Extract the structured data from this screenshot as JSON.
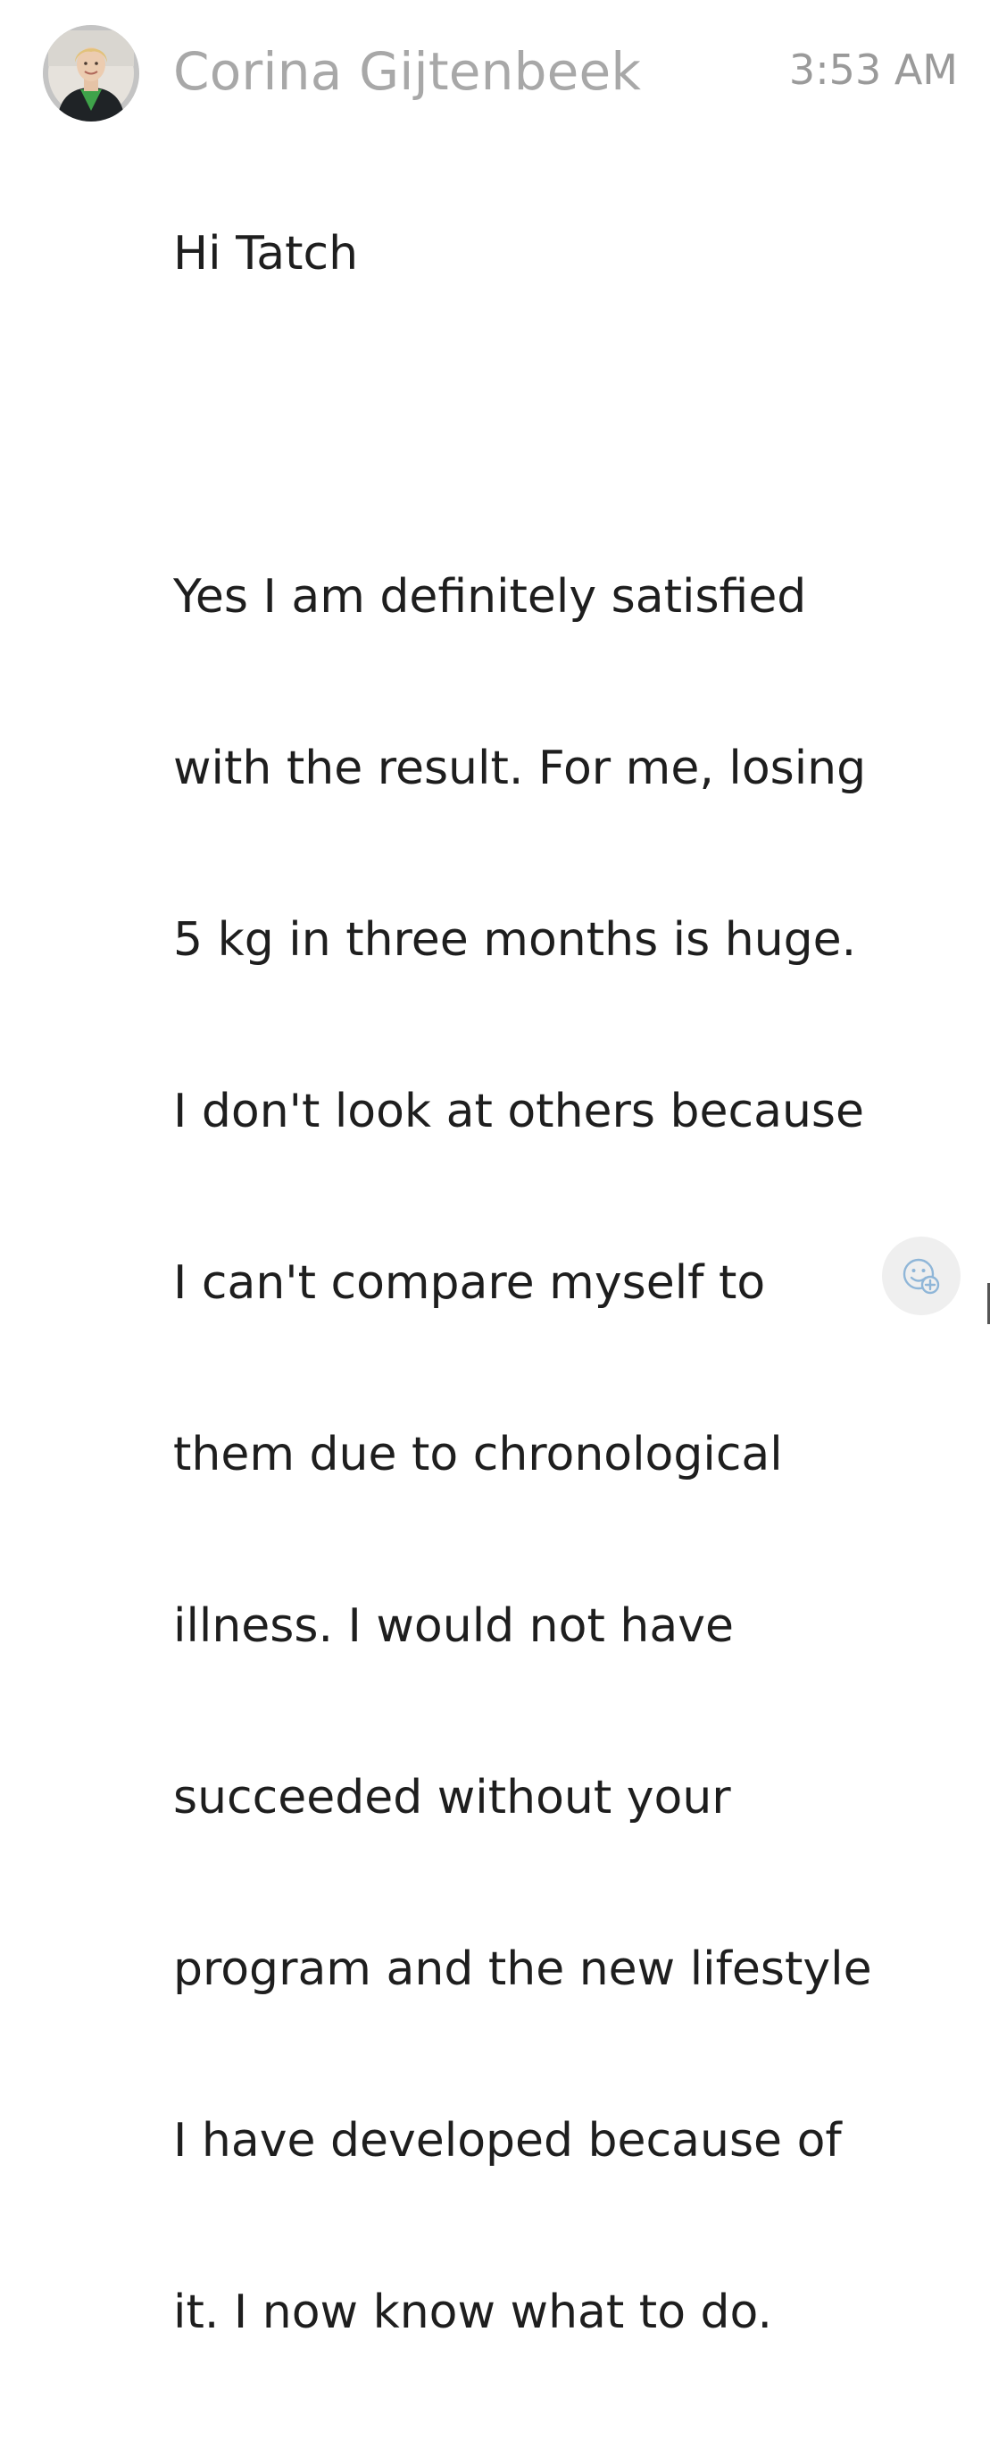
{
  "message": {
    "sender_name": "Corina Gijtenbeek",
    "timestamp": "3:53 AM",
    "greeting": "Hi Tatch",
    "body_lines": [
      "Yes I am definitely satisfied",
      "with the result. For me, losing",
      "5 kg in three months is huge.",
      "I don't look at others because",
      "I can't compare myself to",
      "them due to chronological",
      "illness. I would not have",
      "succeeded without your",
      "program and the new lifestyle",
      "I have developed because of",
      "it. I now know what to do."
    ]
  },
  "icons": {
    "avatar": "profile-photo",
    "reaction": "add-reaction-icon"
  },
  "colors": {
    "sender_name": "#a8a8a8",
    "timestamp": "#9a9a9a",
    "body_text": "#1e1e1e",
    "reaction_button_bg": "#efefef",
    "reaction_icon": "#8fb6d8"
  }
}
